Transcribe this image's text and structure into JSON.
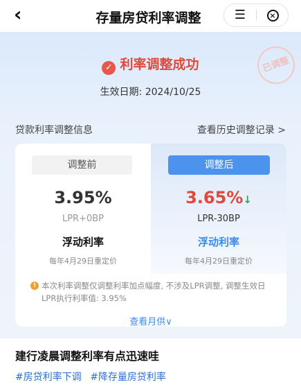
{
  "header": {
    "back_icon": "‹",
    "title": "存量房贷利率调整",
    "menu_icon": "☰",
    "close_icon": "×"
  },
  "status": {
    "success_text": "利率调整成功",
    "effective_date": "生效日期: 2024/10/25",
    "stamp_text": "已调整"
  },
  "section": {
    "info_label": "贷款利率调整信息",
    "history_link": "查看历史调整记录 >"
  },
  "before": {
    "tag": "调整前",
    "rate": "3.95%",
    "lpr": "LPR+0BP",
    "type": "浮动利率",
    "reset": "每年4月29日重定价"
  },
  "after": {
    "tag": "调整后",
    "rate": "3.65%",
    "arrow": "↓",
    "lpr": "LPR-30BP",
    "type": "浮动利率",
    "reset": "每年4月29日重定价"
  },
  "note": "本次利率调整仅调整利率加点幅度, 不涉及LPR调整, 调整生效日LPR执行利率值: 3.95%",
  "monthly_link": "查看月供∨",
  "post": {
    "title": "建行凌晨调整利率有点迅速哇",
    "tags": [
      "#房贷利率下调",
      "#降存量房贷利率"
    ]
  },
  "colors": {
    "accent_blue": "#4b93ec",
    "success_red": "#e0493c",
    "down_green": "#2ea55f"
  }
}
